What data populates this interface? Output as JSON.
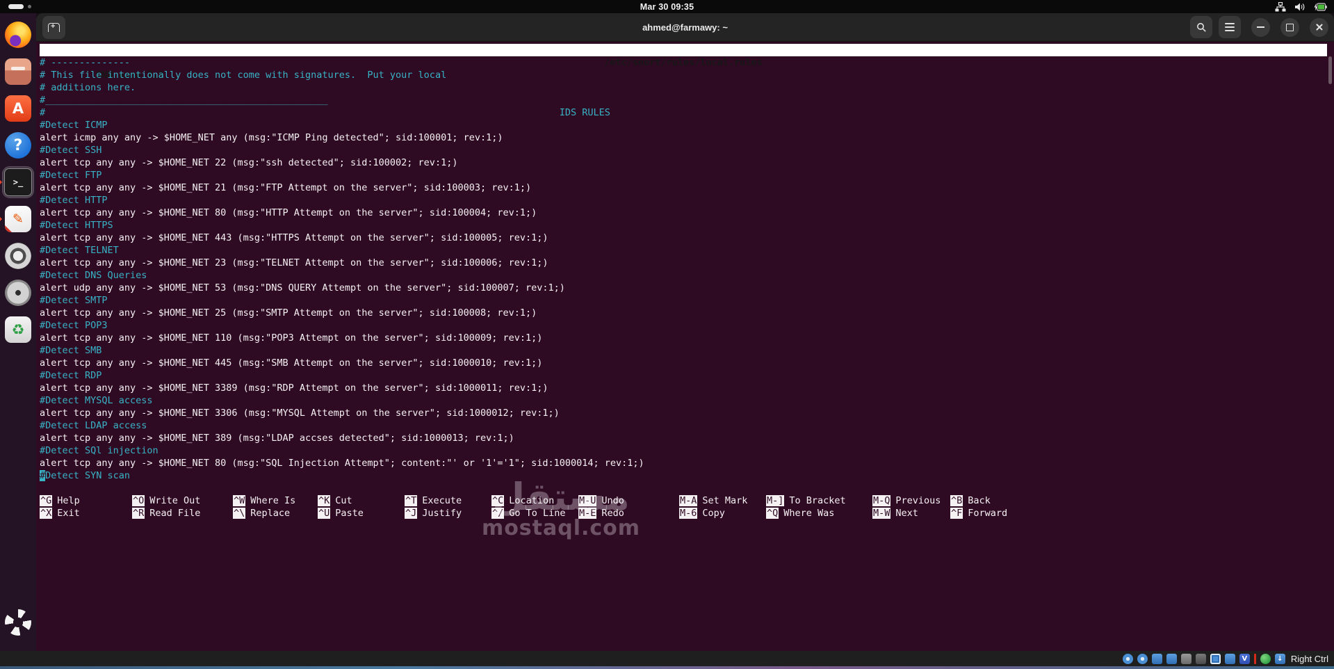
{
  "colors": {
    "terminal_bg": "#2f0a23",
    "comment_cyan": "#38b3c6",
    "text_white": "#f5f1f3",
    "nano_bar_bg": "#ffffff",
    "titlebar_bg": "#242424",
    "dock_bg": "#241324",
    "accent_red": "#e8452c"
  },
  "top_bar": {
    "clock": "Mar 30 09:35",
    "tray": [
      "network-icon",
      "volume-icon",
      "battery-charging-icon"
    ]
  },
  "dock": {
    "items": [
      {
        "name": "firefox",
        "cls": "ic-firefox",
        "glyph": ""
      },
      {
        "name": "files",
        "cls": "ic-files",
        "glyph": ""
      },
      {
        "name": "app-a",
        "cls": "ic-appa",
        "glyph": "A"
      },
      {
        "name": "help",
        "cls": "ic-help",
        "glyph": "?"
      },
      {
        "name": "terminal",
        "cls": "ic-terminal",
        "glyph": ">_",
        "focused": true,
        "running": true
      },
      {
        "name": "text-editor",
        "cls": "ic-writer",
        "glyph": "✎",
        "running": true
      },
      {
        "name": "media-player",
        "cls": "ic-lens",
        "glyph": ""
      },
      {
        "name": "disks",
        "cls": "ic-disc",
        "glyph": ""
      },
      {
        "name": "software-updater",
        "cls": "ic-recycle",
        "glyph": "♻"
      }
    ]
  },
  "window": {
    "title": "ahmed@farmawy: ~"
  },
  "nano": {
    "version_label": "  GNU nano 7.2",
    "file_path": "/etc/snort/rules/local.rules",
    "lines": [
      "# --------------",
      "# This file intentionally does not come with signatures.  Put your local",
      "# additions here.",
      "#__________________________________________________",
      "#                                                                                           IDS RULES",
      "#Detect ICMP",
      "alert icmp any any -> $HOME_NET any (msg:\"ICMP Ping detected\"; sid:100001; rev:1;)",
      "#Detect SSH",
      "alert tcp any any -> $HOME_NET 22 (msg:\"ssh detected\"; sid:100002; rev:1;)",
      "#Detect FTP",
      "alert tcp any any -> $HOME_NET 21 (msg:\"FTP Attempt on the server\"; sid:100003; rev:1;)",
      "#Detect HTTP",
      "alert tcp any any -> $HOME_NET 80 (msg:\"HTTP Attempt on the server\"; sid:100004; rev:1;)",
      "#Detect HTTPS",
      "alert tcp any any -> $HOME_NET 443 (msg:\"HTTPS Attempt on the server\"; sid:100005; rev:1;)",
      "#Detect TELNET",
      "alert tcp any any -> $HOME_NET 23 (msg:\"TELNET Attempt on the server\"; sid:100006; rev:1;)",
      "#Detect DNS Queries",
      "alert udp any any -> $HOME_NET 53 (msg:\"DNS QUERY Attempt on the server\"; sid:100007; rev:1;)",
      "#Detect SMTP",
      "alert tcp any any -> $HOME_NET 25 (msg:\"SMTP Attempt on the server\"; sid:100008; rev:1;)",
      "#Detect POP3",
      "alert tcp any any -> $HOME_NET 110 (msg:\"POP3 Attempt on the server\"; sid:100009; rev:1;)",
      "#Detect SMB",
      "alert tcp any any -> $HOME_NET 445 (msg:\"SMB Attempt on the server\"; sid:1000010; rev:1;)",
      "#Detect RDP",
      "alert tcp any any -> $HOME_NET 3389 (msg:\"RDP Attempt on the server\"; sid:1000011; rev:1;)",
      "#Detect MYSQL access",
      "alert tcp any any -> $HOME_NET 3306 (msg:\"MYSQL Attempt on the server\"; sid:1000012; rev:1;)",
      "#Detect LDAP access",
      "alert tcp any any -> $HOME_NET 389 (msg:\"LDAP accses detected\"; sid:1000013; rev:1;)",
      "#Detect SQl injection",
      "alert tcp any any -> $HOME_NET 80 (msg:\"SQL Injection Attempt\"; content:\"' or '1'='1\"; sid:1000014; rev:1;)",
      "#Detect SYN scan"
    ],
    "cursor": {
      "line": 33,
      "col": 0
    },
    "shortcut_columns": [
      [
        [
          "^G",
          "Help"
        ],
        [
          "^X",
          "Exit"
        ]
      ],
      [
        [
          "^O",
          "Write Out"
        ],
        [
          "^R",
          "Read File"
        ]
      ],
      [
        [
          "^W",
          "Where Is"
        ],
        [
          "^\\",
          "Replace"
        ]
      ],
      [
        [
          "^K",
          "Cut"
        ],
        [
          "^U",
          "Paste"
        ]
      ],
      [
        [
          "^T",
          "Execute"
        ],
        [
          "^J",
          "Justify"
        ]
      ],
      [
        [
          "^C",
          "Location"
        ],
        [
          "^/",
          "Go To Line"
        ]
      ],
      [
        [
          "M-U",
          "Undo"
        ],
        [
          "M-E",
          "Redo"
        ]
      ],
      [
        [
          "M-A",
          "Set Mark"
        ],
        [
          "M-6",
          "Copy"
        ]
      ],
      [
        [
          "M-]",
          "To Bracket"
        ],
        [
          "^Q",
          "Where Was"
        ]
      ],
      [
        [
          "M-Q",
          "Previous"
        ],
        [
          "M-W",
          "Next"
        ]
      ],
      [
        [
          "^B",
          "Back"
        ],
        [
          "^F",
          "Forward"
        ]
      ]
    ]
  },
  "watermark": {
    "line1": "مستقل",
    "line2": "mostaql.com"
  },
  "vbox_bar": {
    "host_key_label": "Right Ctrl",
    "icons": [
      {
        "name": "hard-disk",
        "cls": "vc-bluedisc",
        "glyph": ""
      },
      {
        "name": "optical-disc",
        "cls": "vc-bluedisc",
        "glyph": ""
      },
      {
        "name": "audio",
        "cls": "vc-blue",
        "glyph": ""
      },
      {
        "name": "network-adapters",
        "cls": "vc-blue",
        "glyph": ""
      },
      {
        "name": "usb-devices",
        "cls": "vc-gray",
        "glyph": ""
      },
      {
        "name": "shared-folders",
        "cls": "vc-darkgray",
        "glyph": ""
      },
      {
        "name": "display",
        "cls": "vc-display",
        "glyph": ""
      },
      {
        "name": "screens",
        "cls": "vc-blue",
        "glyph": ""
      },
      {
        "name": "virtualbox-guest",
        "cls": "vc-vbox",
        "glyph": "V"
      },
      {
        "name": "recording-indicator",
        "cls": "vc-sep",
        "glyph": "",
        "sep": true
      },
      {
        "name": "mouse-integration",
        "cls": "vc-green",
        "glyph": ""
      },
      {
        "name": "keyboard-capture",
        "cls": "vc-blue",
        "glyph": "↓"
      }
    ]
  }
}
